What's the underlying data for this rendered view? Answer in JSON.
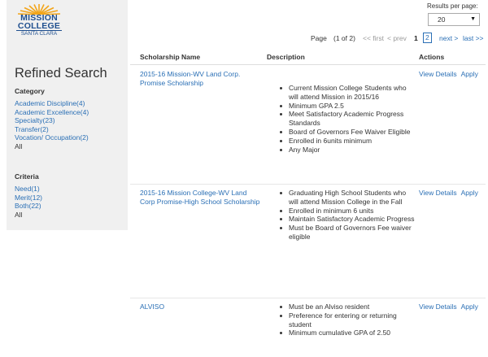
{
  "logo": {
    "line1": "MISSION",
    "line2": "COLLEGE",
    "line3": "SANTA CLARA"
  },
  "sidebar": {
    "title": "Refined Search",
    "category": {
      "heading": "Category",
      "items": [
        "Academic Discipline(4)",
        "Academic Excellence(4)",
        "Specialty(23)",
        "Transfer(2)",
        "Vocation/ Occupation(2)",
        "All"
      ]
    },
    "criteria": {
      "heading": "Criteria",
      "items": [
        "Need(1)",
        "Merit(12)",
        "Both(22)",
        "All"
      ]
    }
  },
  "results_per_page": {
    "label": "Results per page:",
    "value": "20"
  },
  "pager": {
    "page_label": "Page",
    "of": "(1 of 2)",
    "first": "<< first",
    "prev": "< prev",
    "page1": "1",
    "page2": "2",
    "next": "next >",
    "last": "last >>"
  },
  "table": {
    "headers": {
      "name": "Scholarship Name",
      "description": "Description",
      "actions": "Actions"
    },
    "rows": [
      {
        "name": "2015-16 Mission-WV Land Corp. Promise Scholarship",
        "bullets": [
          "Current Mission College Students who will attend Mission in 2015/16",
          "Minimum GPA 2.5",
          "Meet Satisfactory Academic Progress Standards",
          "Board of Governors Fee Waiver Eligible",
          "Enrolled in 6units minimum",
          "Any Major"
        ],
        "view": "View Details",
        "apply": "Apply"
      },
      {
        "name": "2015-16 Mission College-WV Land Corp Promise-High School Scholarship",
        "bullets": [
          "Graduating High School Students who will attend Mission College in the Fall",
          "Enrolled in minimum 6 units",
          "Maintain Satisfactory Academic Progress",
          "Must be Board of Governors Fee waiver eligible"
        ],
        "view": "View Details",
        "apply": "Apply"
      },
      {
        "name": "ALVISO",
        "bullets": [
          "Must be an Alviso resident",
          "Preference for entering or returning student",
          "Minimum cumulative GPA of 2.50"
        ],
        "view": "View Details",
        "apply": "Apply"
      }
    ]
  },
  "colors": {
    "link": "#2a6fb5",
    "logo": "#1f4f8f",
    "sun": "#f2a51a",
    "sidebar_bg": "#f0f0f0"
  }
}
